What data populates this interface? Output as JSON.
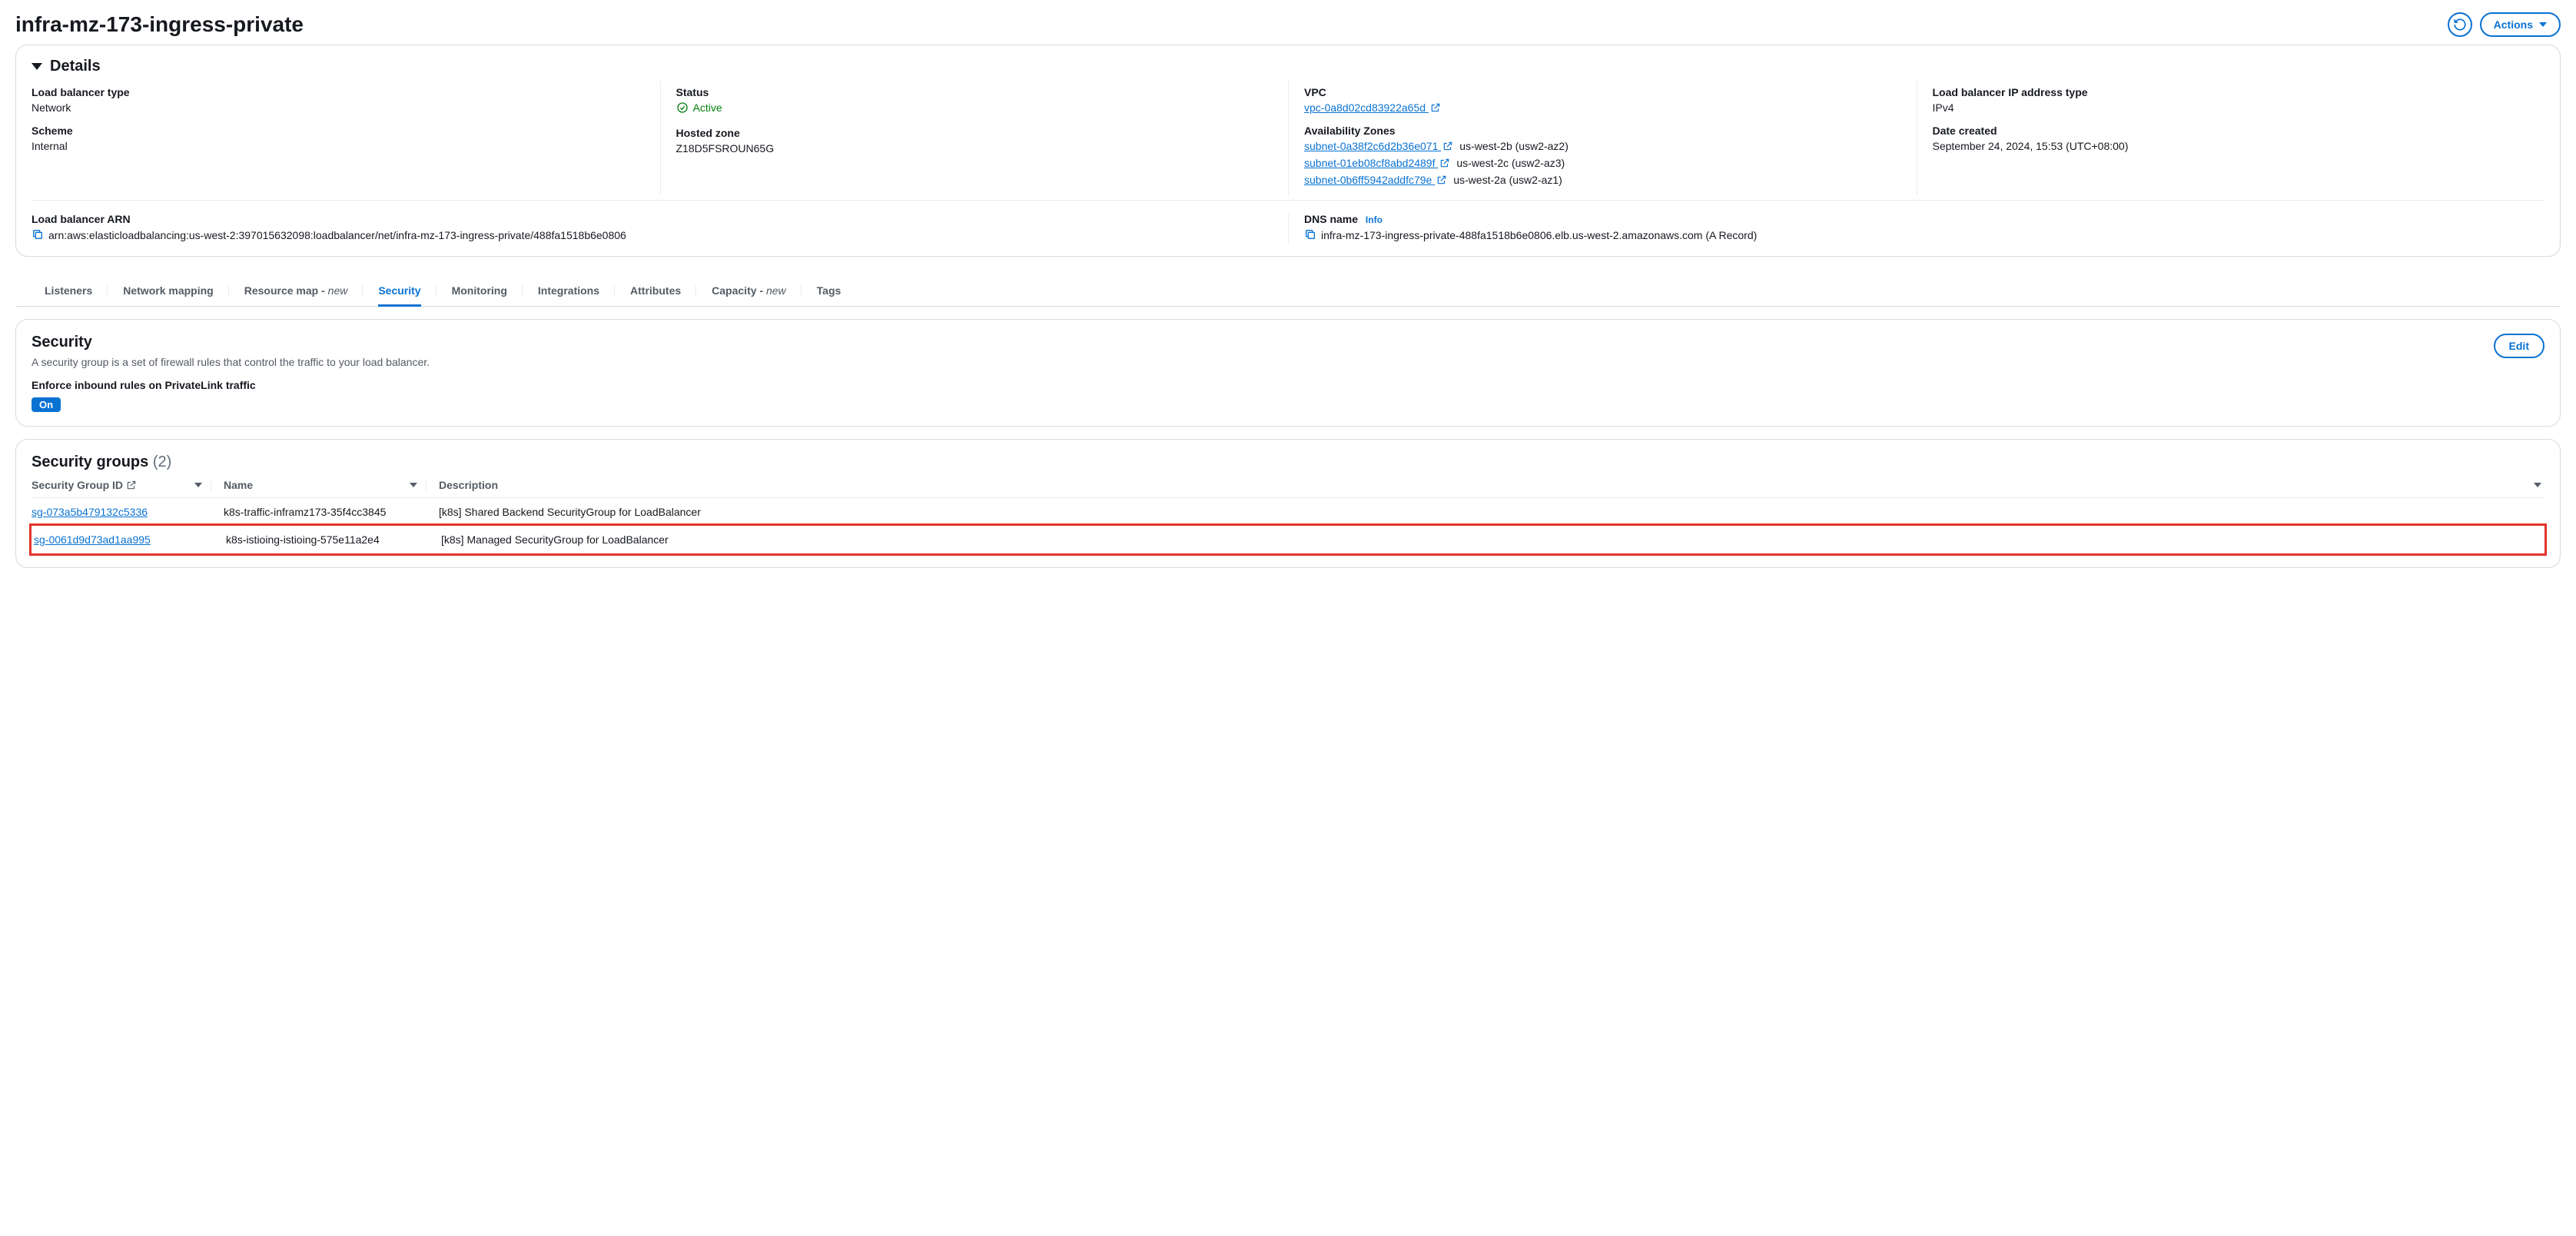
{
  "header": {
    "title": "infra-mz-173-ingress-private",
    "actions_label": "Actions"
  },
  "details": {
    "heading": "Details",
    "lb_type_label": "Load balancer type",
    "lb_type_value": "Network",
    "scheme_label": "Scheme",
    "scheme_value": "Internal",
    "status_label": "Status",
    "status_value": "Active",
    "hosted_zone_label": "Hosted zone",
    "hosted_zone_value": "Z18D5FSROUN65G",
    "vpc_label": "VPC",
    "vpc_link": "vpc-0a8d02cd83922a65d",
    "az_label": "Availability Zones",
    "azs": [
      {
        "subnet": "subnet-0a38f2c6d2b36e071",
        "suffix": "us-west-2b (usw2-az2)"
      },
      {
        "subnet": "subnet-01eb08cf8abd2489f",
        "suffix": "us-west-2c (usw2-az3)"
      },
      {
        "subnet": "subnet-0b6ff5942addfc79e",
        "suffix": "us-west-2a (usw2-az1)"
      }
    ],
    "ip_type_label": "Load balancer IP address type",
    "ip_type_value": "IPv4",
    "created_label": "Date created",
    "created_value": "September 24, 2024, 15:53 (UTC+08:00)",
    "arn_label": "Load balancer ARN",
    "arn_value": "arn:aws:elasticloadbalancing:us-west-2:397015632098:loadbalancer/net/infra-mz-173-ingress-private/488fa1518b6e0806",
    "dns_label": "DNS name",
    "dns_info": "Info",
    "dns_value": "infra-mz-173-ingress-private-488fa1518b6e0806.elb.us-west-2.amazonaws.com (A Record)"
  },
  "tabs": {
    "listeners": "Listeners",
    "network_mapping": "Network mapping",
    "resource_map": "Resource map - ",
    "resource_map_new": "new",
    "security": "Security",
    "monitoring": "Monitoring",
    "integrations": "Integrations",
    "attributes": "Attributes",
    "capacity": "Capacity - ",
    "capacity_new": "new",
    "tags": "Tags"
  },
  "security": {
    "title": "Security",
    "desc": "A security group is a set of firewall rules that control the traffic to your load balancer.",
    "edit": "Edit",
    "enforce_label": "Enforce inbound rules on PrivateLink traffic",
    "on_badge": "On"
  },
  "sg": {
    "title": "Security groups",
    "count": "(2)",
    "col_id": "Security Group ID",
    "col_name": "Name",
    "col_desc": "Description",
    "rows": [
      {
        "id": "sg-073a5b479132c5336",
        "name": "k8s-traffic-inframz173-35f4cc3845",
        "desc": "[k8s] Shared Backend SecurityGroup for LoadBalancer",
        "highlight": false
      },
      {
        "id": "sg-0061d9d73ad1aa995",
        "name": "k8s-istioing-istioing-575e11a2e4",
        "desc": "[k8s] Managed SecurityGroup for LoadBalancer",
        "highlight": true
      }
    ]
  }
}
